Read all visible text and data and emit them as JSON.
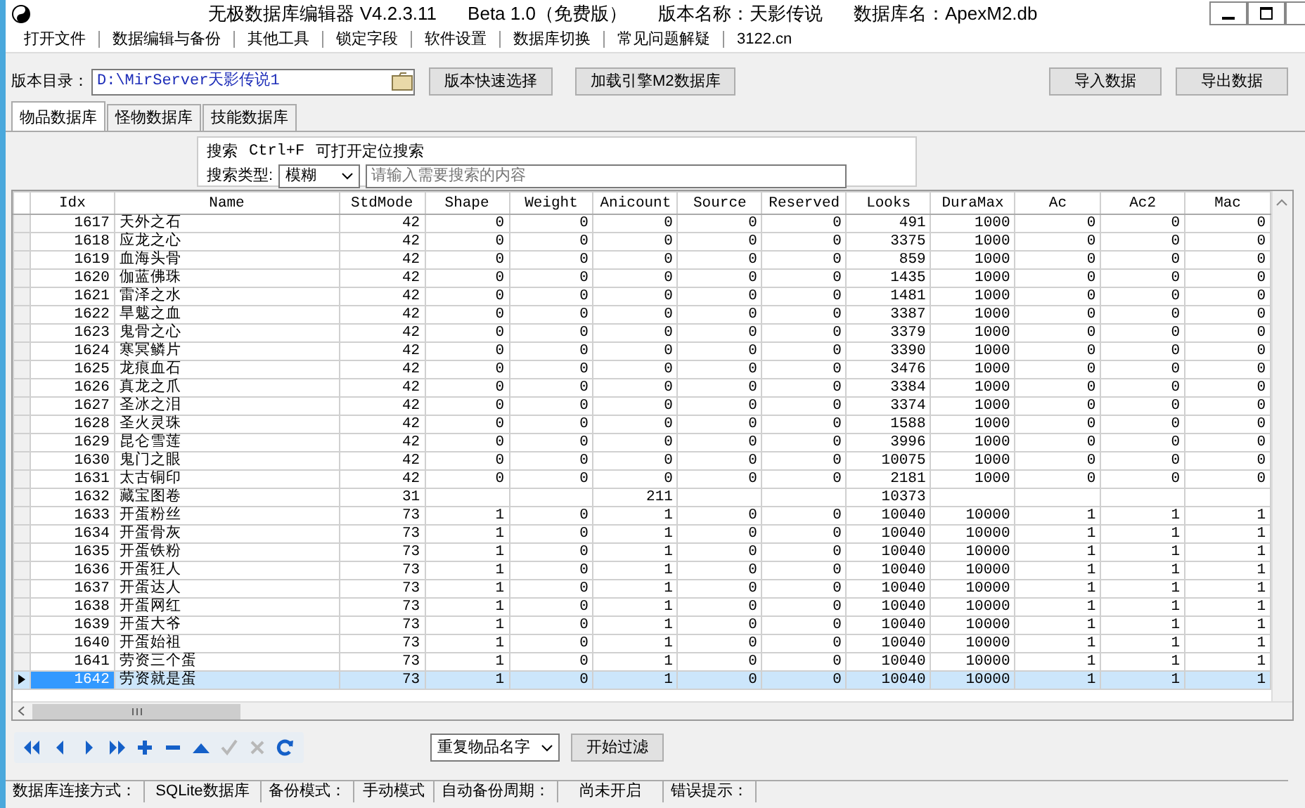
{
  "window": {
    "title_parts": [
      "无极数据库编辑器 V4.2.3.11",
      "Beta 1.0（免费版）",
      "版本名称：天影传说",
      "数据库名：ApexM2.db"
    ]
  },
  "menu": [
    "打开文件",
    "数据编辑与备份",
    "其他工具",
    "锁定字段",
    "软件设置",
    "数据库切换",
    "常见问题解疑",
    "3122.cn"
  ],
  "directory": {
    "label": "版本目录：",
    "value": "D:\\MirServer天影传说1"
  },
  "top_buttons": [
    "版本快速选择",
    "加载引擎M2数据库"
  ],
  "right_buttons": [
    "导入数据",
    "导出数据"
  ],
  "tabs": [
    {
      "label": "物品数据库",
      "selected": true
    },
    {
      "label": "怪物数据库",
      "selected": false
    },
    {
      "label": "技能数据库",
      "selected": false
    }
  ],
  "search": {
    "hint_label": "搜索",
    "hint_keys": "Ctrl+F",
    "hint_text": "可打开定位搜索",
    "type_label": "搜索类型:",
    "type_value": "模糊",
    "placeholder": "请输入需要搜索的内容"
  },
  "table": {
    "columns": [
      "Idx",
      "Name",
      "StdMode",
      "Shape",
      "Weight",
      "Anicount",
      "Source",
      "Reserved",
      "Looks",
      "DuraMax",
      "Ac",
      "Ac2",
      "Mac"
    ],
    "rows": [
      {
        "selected": false,
        "cells": [
          "1617",
          "天外之石",
          "42",
          "0",
          "0",
          "0",
          "0",
          "0",
          "491",
          "1000",
          "0",
          "0",
          "0"
        ]
      },
      {
        "selected": false,
        "cells": [
          "1618",
          "应龙之心",
          "42",
          "0",
          "0",
          "0",
          "0",
          "0",
          "3375",
          "1000",
          "0",
          "0",
          "0"
        ]
      },
      {
        "selected": false,
        "cells": [
          "1619",
          "血海头骨",
          "42",
          "0",
          "0",
          "0",
          "0",
          "0",
          "859",
          "1000",
          "0",
          "0",
          "0"
        ]
      },
      {
        "selected": false,
        "cells": [
          "1620",
          "伽蓝佛珠",
          "42",
          "0",
          "0",
          "0",
          "0",
          "0",
          "1435",
          "1000",
          "0",
          "0",
          "0"
        ]
      },
      {
        "selected": false,
        "cells": [
          "1621",
          "雷泽之水",
          "42",
          "0",
          "0",
          "0",
          "0",
          "0",
          "1481",
          "1000",
          "0",
          "0",
          "0"
        ]
      },
      {
        "selected": false,
        "cells": [
          "1622",
          "旱魃之血",
          "42",
          "0",
          "0",
          "0",
          "0",
          "0",
          "3387",
          "1000",
          "0",
          "0",
          "0"
        ]
      },
      {
        "selected": false,
        "cells": [
          "1623",
          "鬼骨之心",
          "42",
          "0",
          "0",
          "0",
          "0",
          "0",
          "3379",
          "1000",
          "0",
          "0",
          "0"
        ]
      },
      {
        "selected": false,
        "cells": [
          "1624",
          "寒冥鳞片",
          "42",
          "0",
          "0",
          "0",
          "0",
          "0",
          "3390",
          "1000",
          "0",
          "0",
          "0"
        ]
      },
      {
        "selected": false,
        "cells": [
          "1625",
          "龙痕血石",
          "42",
          "0",
          "0",
          "0",
          "0",
          "0",
          "3476",
          "1000",
          "0",
          "0",
          "0"
        ]
      },
      {
        "selected": false,
        "cells": [
          "1626",
          "真龙之爪",
          "42",
          "0",
          "0",
          "0",
          "0",
          "0",
          "3384",
          "1000",
          "0",
          "0",
          "0"
        ]
      },
      {
        "selected": false,
        "cells": [
          "1627",
          "圣冰之泪",
          "42",
          "0",
          "0",
          "0",
          "0",
          "0",
          "3374",
          "1000",
          "0",
          "0",
          "0"
        ]
      },
      {
        "selected": false,
        "cells": [
          "1628",
          "圣火灵珠",
          "42",
          "0",
          "0",
          "0",
          "0",
          "0",
          "1588",
          "1000",
          "0",
          "0",
          "0"
        ]
      },
      {
        "selected": false,
        "cells": [
          "1629",
          "昆仑雪莲",
          "42",
          "0",
          "0",
          "0",
          "0",
          "0",
          "3996",
          "1000",
          "0",
          "0",
          "0"
        ]
      },
      {
        "selected": false,
        "cells": [
          "1630",
          "鬼门之眼",
          "42",
          "0",
          "0",
          "0",
          "0",
          "0",
          "10075",
          "1000",
          "0",
          "0",
          "0"
        ]
      },
      {
        "selected": false,
        "cells": [
          "1631",
          "太古铜印",
          "42",
          "0",
          "0",
          "0",
          "0",
          "0",
          "2181",
          "1000",
          "0",
          "0",
          "0"
        ]
      },
      {
        "selected": false,
        "cells": [
          "1632",
          "藏宝图卷",
          "31",
          null,
          null,
          "211",
          null,
          null,
          "10373",
          null,
          null,
          null,
          null
        ]
      },
      {
        "selected": false,
        "cells": [
          "1633",
          "开蛋粉丝",
          "73",
          "1",
          "0",
          "1",
          "0",
          "0",
          "10040",
          "10000",
          "1",
          "1",
          "1"
        ]
      },
      {
        "selected": false,
        "cells": [
          "1634",
          "开蛋骨灰",
          "73",
          "1",
          "0",
          "1",
          "0",
          "0",
          "10040",
          "10000",
          "1",
          "1",
          "1"
        ]
      },
      {
        "selected": false,
        "cells": [
          "1635",
          "开蛋铁粉",
          "73",
          "1",
          "0",
          "1",
          "0",
          "0",
          "10040",
          "10000",
          "1",
          "1",
          "1"
        ]
      },
      {
        "selected": false,
        "cells": [
          "1636",
          "开蛋狂人",
          "73",
          "1",
          "0",
          "1",
          "0",
          "0",
          "10040",
          "10000",
          "1",
          "1",
          "1"
        ]
      },
      {
        "selected": false,
        "cells": [
          "1637",
          "开蛋达人",
          "73",
          "1",
          "0",
          "1",
          "0",
          "0",
          "10040",
          "10000",
          "1",
          "1",
          "1"
        ]
      },
      {
        "selected": false,
        "cells": [
          "1638",
          "开蛋网红",
          "73",
          "1",
          "0",
          "1",
          "0",
          "0",
          "10040",
          "10000",
          "1",
          "1",
          "1"
        ]
      },
      {
        "selected": false,
        "cells": [
          "1639",
          "开蛋大爷",
          "73",
          "1",
          "0",
          "1",
          "0",
          "0",
          "10040",
          "10000",
          "1",
          "1",
          "1"
        ]
      },
      {
        "selected": false,
        "cells": [
          "1640",
          "开蛋始祖",
          "73",
          "1",
          "0",
          "1",
          "0",
          "0",
          "10040",
          "10000",
          "1",
          "1",
          "1"
        ]
      },
      {
        "selected": false,
        "cells": [
          "1641",
          "劳资三个蛋",
          "73",
          "1",
          "0",
          "1",
          "0",
          "0",
          "10040",
          "10000",
          "1",
          "1",
          "1"
        ]
      },
      {
        "selected": true,
        "cells": [
          "1642",
          "劳资就是蛋",
          "73",
          "1",
          "0",
          "1",
          "0",
          "0",
          "10040",
          "10000",
          "1",
          "1",
          "1"
        ]
      }
    ]
  },
  "navigator": [
    {
      "kind": "first",
      "disabled": false
    },
    {
      "kind": "prior",
      "disabled": false
    },
    {
      "kind": "next",
      "disabled": false
    },
    {
      "kind": "last",
      "disabled": false
    },
    {
      "kind": "insert",
      "disabled": false
    },
    {
      "kind": "delete",
      "disabled": false
    },
    {
      "kind": "edit",
      "disabled": false
    },
    {
      "kind": "post",
      "disabled": true
    },
    {
      "kind": "cancel",
      "disabled": true
    },
    {
      "kind": "refresh",
      "disabled": false
    }
  ],
  "filter": {
    "select_value": "重复物品名字",
    "button": "开始过滤"
  },
  "status_bar": [
    "数据库连接方式：",
    "SQLite数据库",
    "备份模式：",
    "手动模式",
    "自动备份周期：",
    "尚未开启",
    "错误提示："
  ]
}
